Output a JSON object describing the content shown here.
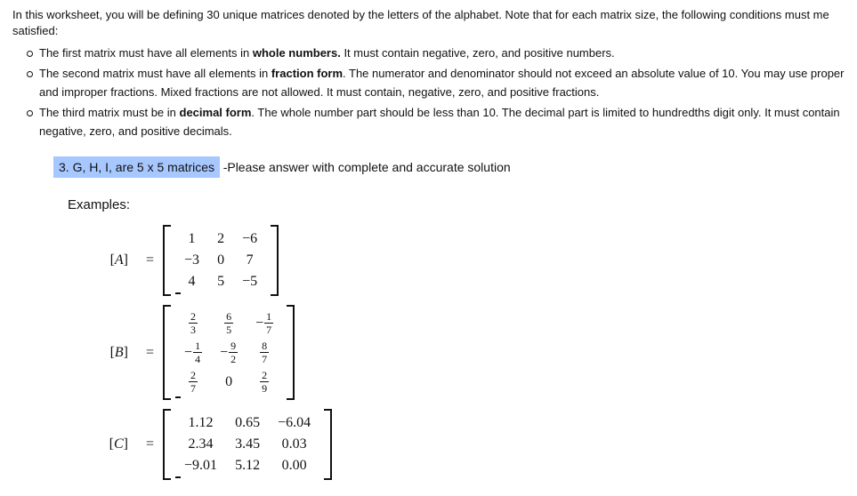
{
  "intro": "In this worksheet, you will be defining 30 unique matrices denoted by the letters of the alphabet. Note that for each matrix size, the following conditions must me satisfied:",
  "bullets": [
    {
      "pre": "The first matrix must have all elements in ",
      "bold": "whole numbers.",
      "post": " It must contain negative, zero, and positive numbers."
    },
    {
      "pre": "The second matrix must have all elements in ",
      "bold": "fraction form",
      "post": ". The numerator and denominator should not exceed an absolute value of 10. You may use proper and improper fractions. Mixed fractions are not allowed. It must contain, negative, zero, and positive fractions."
    },
    {
      "pre": "The third matrix must be in ",
      "bold": "decimal form",
      "post": ". The whole number part should be less than 10. The decimal part is limited to hundredths digit only. It must contain negative, zero, and positive decimals."
    }
  ],
  "highlight": "3. G, H, I, are 5 x 5 matrices",
  "please": "-Please answer with complete and accurate solution",
  "examples_label": "Examples:",
  "matrix_A": {
    "label": "[A]",
    "rows": [
      [
        "1",
        "2",
        "−6"
      ],
      [
        "−3",
        "0",
        "7"
      ],
      [
        "4",
        "5",
        "−5"
      ]
    ]
  },
  "matrix_B": {
    "label": "[B]",
    "rows": [
      [
        {
          "n": "2",
          "d": "3"
        },
        {
          "n": "6",
          "d": "5"
        },
        {
          "neg": true,
          "n": "1",
          "d": "7"
        }
      ],
      [
        {
          "neg": true,
          "n": "1",
          "d": "4"
        },
        {
          "neg": true,
          "n": "9",
          "d": "2"
        },
        {
          "n": "8",
          "d": "7"
        }
      ],
      [
        {
          "n": "2",
          "d": "7"
        },
        {
          "plain": "0"
        },
        {
          "n": "2",
          "d": "9"
        }
      ]
    ]
  },
  "matrix_C": {
    "label": "[C]",
    "rows": [
      [
        "1.12",
        "0.65",
        "−6.04"
      ],
      [
        "2.34",
        "3.45",
        "0.03"
      ],
      [
        "−9.01",
        "5.12",
        "0.00"
      ]
    ]
  }
}
